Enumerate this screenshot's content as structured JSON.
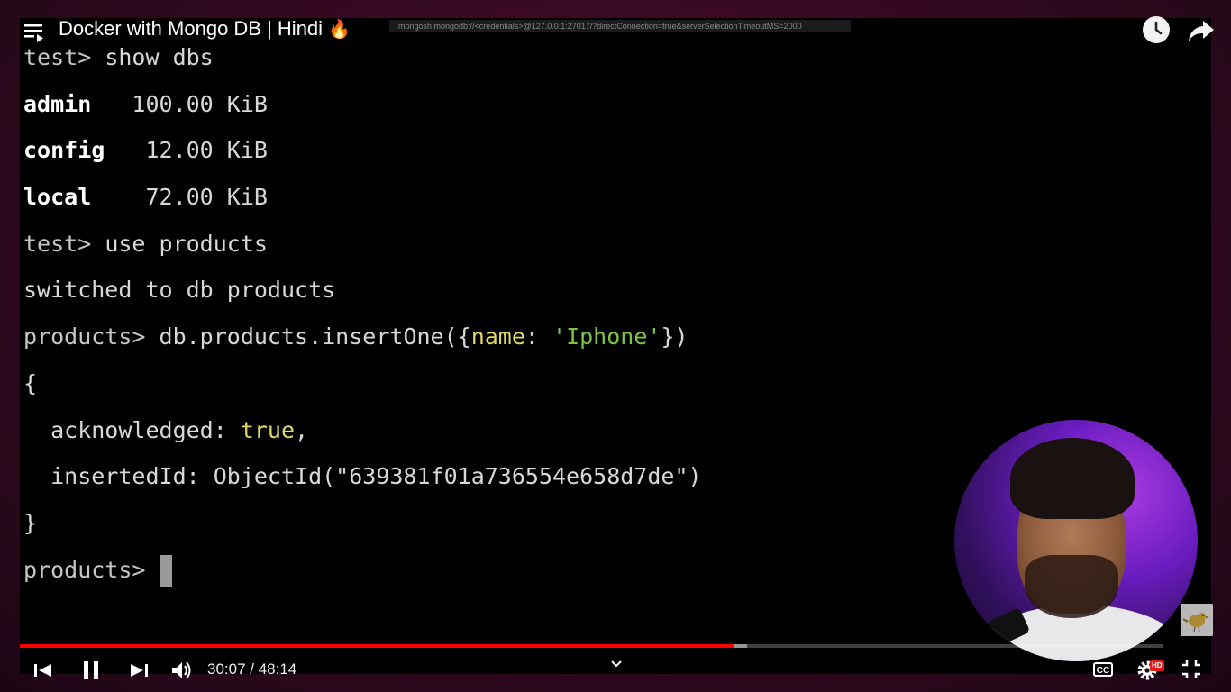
{
  "player": {
    "title": "Docker with Mongo DB | Hindi",
    "title_emoji": "🔥",
    "time_display": "30:07 / 48:14",
    "progress_played": 0.6245,
    "progress_buffered": 0.6365,
    "cc_label": "CC",
    "hd_label": "HD",
    "accent_color": "#ff0000"
  },
  "terminal": {
    "command_bar": "mongosh mongodb://<credentials>@127.0.0.1:27017/?directConnection=true&serverSelectionTimeoutMS=2000",
    "lines": {
      "l1_prompt": "test> ",
      "l1_cmd": "show dbs",
      "db_admin_name": "admin",
      "db_admin_size": "   100.00 KiB",
      "db_config_name": "config",
      "db_config_size": "   12.00 KiB",
      "db_local_name": "local",
      "db_local_size": "    72.00 KiB",
      "l5_prompt": "test> ",
      "l5_cmd": "use products",
      "l6_text": "switched to db products",
      "l7_prompt": "products> ",
      "l7_cmd_a": "db.products.insertOne({",
      "l7_key": "name",
      "l7_colon": ": ",
      "l7_str": "'Iphone'",
      "l7_cmd_b": "})",
      "l8_brace": "{",
      "l9_key": "  acknowledged: ",
      "l9_val": "true",
      "l9_comma": ",",
      "l10_text": "  insertedId: ObjectId(\"639381f01a736554e658d7de\")",
      "l11_brace": "}",
      "l12_prompt": "products> "
    }
  },
  "icons": {
    "playlist": "playlist-icon",
    "watch_later": "clock-icon",
    "share": "share-icon",
    "prev": "previous-icon",
    "pause": "pause-icon",
    "next": "next-icon",
    "volume": "volume-icon",
    "expand": "chevron-down-icon",
    "captions": "cc-icon",
    "settings": "gear-icon",
    "exit_fullscreen": "exit-fullscreen-icon"
  }
}
